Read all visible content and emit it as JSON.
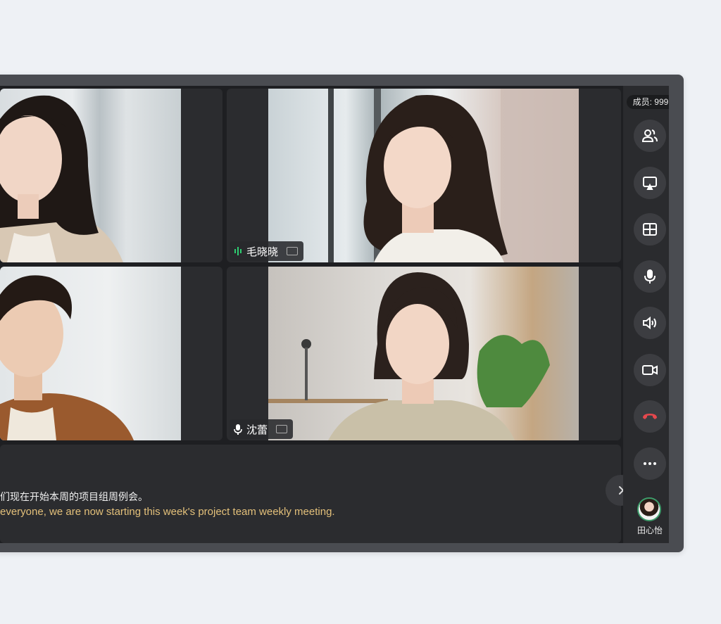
{
  "participants": [
    {
      "name": ""
    },
    {
      "name": "毛晓晓",
      "mic": "speaking"
    },
    {
      "name": ""
    },
    {
      "name": "沈蕾",
      "mic": "on"
    }
  ],
  "caption": {
    "chinese": "们现在开始本周的项目组周例会。",
    "english": "everyone, we are now starting this week's project team weekly meeting."
  },
  "sidebar": {
    "members_label": "成员: 999",
    "controls": [
      {
        "icon": "participants-icon"
      },
      {
        "icon": "screen-share-icon"
      },
      {
        "icon": "grid-layout-icon"
      },
      {
        "icon": "microphone-icon"
      },
      {
        "icon": "speaker-icon"
      },
      {
        "icon": "camera-icon"
      },
      {
        "icon": "hang-up-icon",
        "color": "#e5484d"
      },
      {
        "icon": "more-icon"
      }
    ],
    "user": {
      "name": "田心怡"
    }
  },
  "colors": {
    "caption_english": "#e3c07a",
    "speaking_indicator": "#2ecc71",
    "hang_up": "#e5484d"
  }
}
